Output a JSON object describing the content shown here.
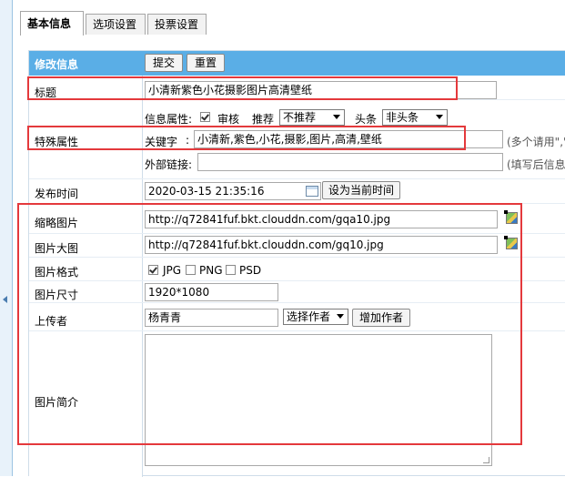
{
  "tabs": [
    {
      "label": "基本信息",
      "active": true
    },
    {
      "label": "选项设置",
      "active": false
    },
    {
      "label": "投票设置",
      "active": false
    }
  ],
  "header": {
    "title": "修改信息",
    "submit_label": "提交",
    "reset_label": "重置"
  },
  "title_row": {
    "label": "标题",
    "value": "小清新紫色小花摄影图片高清壁纸"
  },
  "attr_row": {
    "prefix": "信息属性:",
    "audit_label": "审核",
    "audit_checked": true,
    "recommend_label": "推荐",
    "recommend_value": "不推荐",
    "headline_label": "头条",
    "headline_value": "非头条"
  },
  "special_row": {
    "label": "特殊属性",
    "keyword_label": "关键字",
    "keyword_value": "小清新,紫色,小花,摄影,图片,高清,壁纸",
    "keyword_hint": "(多个请用\",\"",
    "link_label": "外部链接:",
    "link_value": "",
    "link_hint": "(填写后信息"
  },
  "publish_row": {
    "label": "发布时间",
    "value": "2020-03-15 21:35:16",
    "set_now_label": "设为当前时间"
  },
  "thumb_row": {
    "label": "缩略图片",
    "value": "http://q72841fuf.bkt.clouddn.com/gqa10.jpg"
  },
  "bigpic_row": {
    "label": "图片大图",
    "value": "http://q72841fuf.bkt.clouddn.com/gq10.jpg"
  },
  "format_row": {
    "label": "图片格式",
    "options": [
      {
        "label": "JPG",
        "checked": true
      },
      {
        "label": "PNG",
        "checked": false
      },
      {
        "label": "PSD",
        "checked": false
      }
    ]
  },
  "size_row": {
    "label": "图片尺寸",
    "value": "1920*1080"
  },
  "uploader_row": {
    "label": "上传者",
    "value": "杨青青",
    "select_value": "选择作者",
    "add_label": "增加作者"
  },
  "intro_row": {
    "label": "图片简介",
    "value": ""
  },
  "colors": {
    "header_bg": "#5aaee6",
    "highlight": "#e4393c"
  }
}
